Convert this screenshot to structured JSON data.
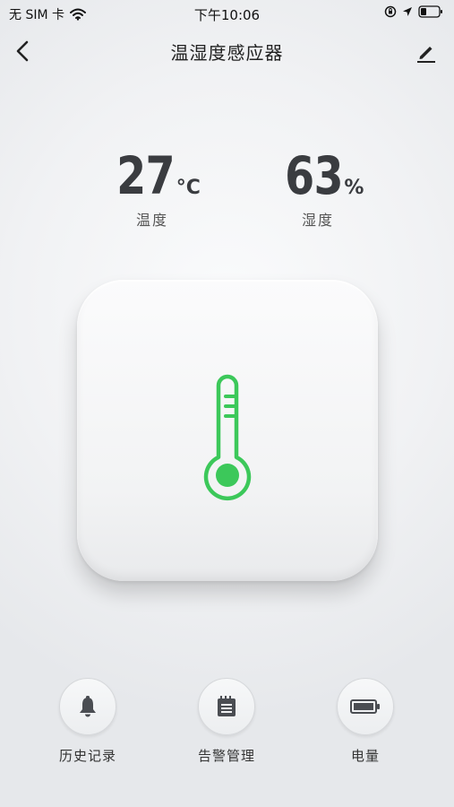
{
  "status_bar": {
    "carrier": "无 SIM 卡",
    "time": "下午10:06",
    "icons": [
      "wifi-icon",
      "orientation-lock-icon",
      "location-icon",
      "battery-icon"
    ]
  },
  "nav": {
    "title": "温湿度感应器",
    "back_icon": "chevron-left-icon",
    "edit_icon": "pencil-icon"
  },
  "readings": {
    "temperature": {
      "value": "27",
      "unit": "°C",
      "label": "温度"
    },
    "humidity": {
      "value": "63",
      "unit": "%",
      "label": "湿度"
    }
  },
  "device": {
    "icon": "thermometer-icon",
    "accent_color": "#3cc85a"
  },
  "actions": [
    {
      "label": "历史记录",
      "icon": "bell-icon"
    },
    {
      "label": "告警管理",
      "icon": "calendar-list-icon"
    },
    {
      "label": "电量",
      "icon": "battery-icon"
    }
  ]
}
